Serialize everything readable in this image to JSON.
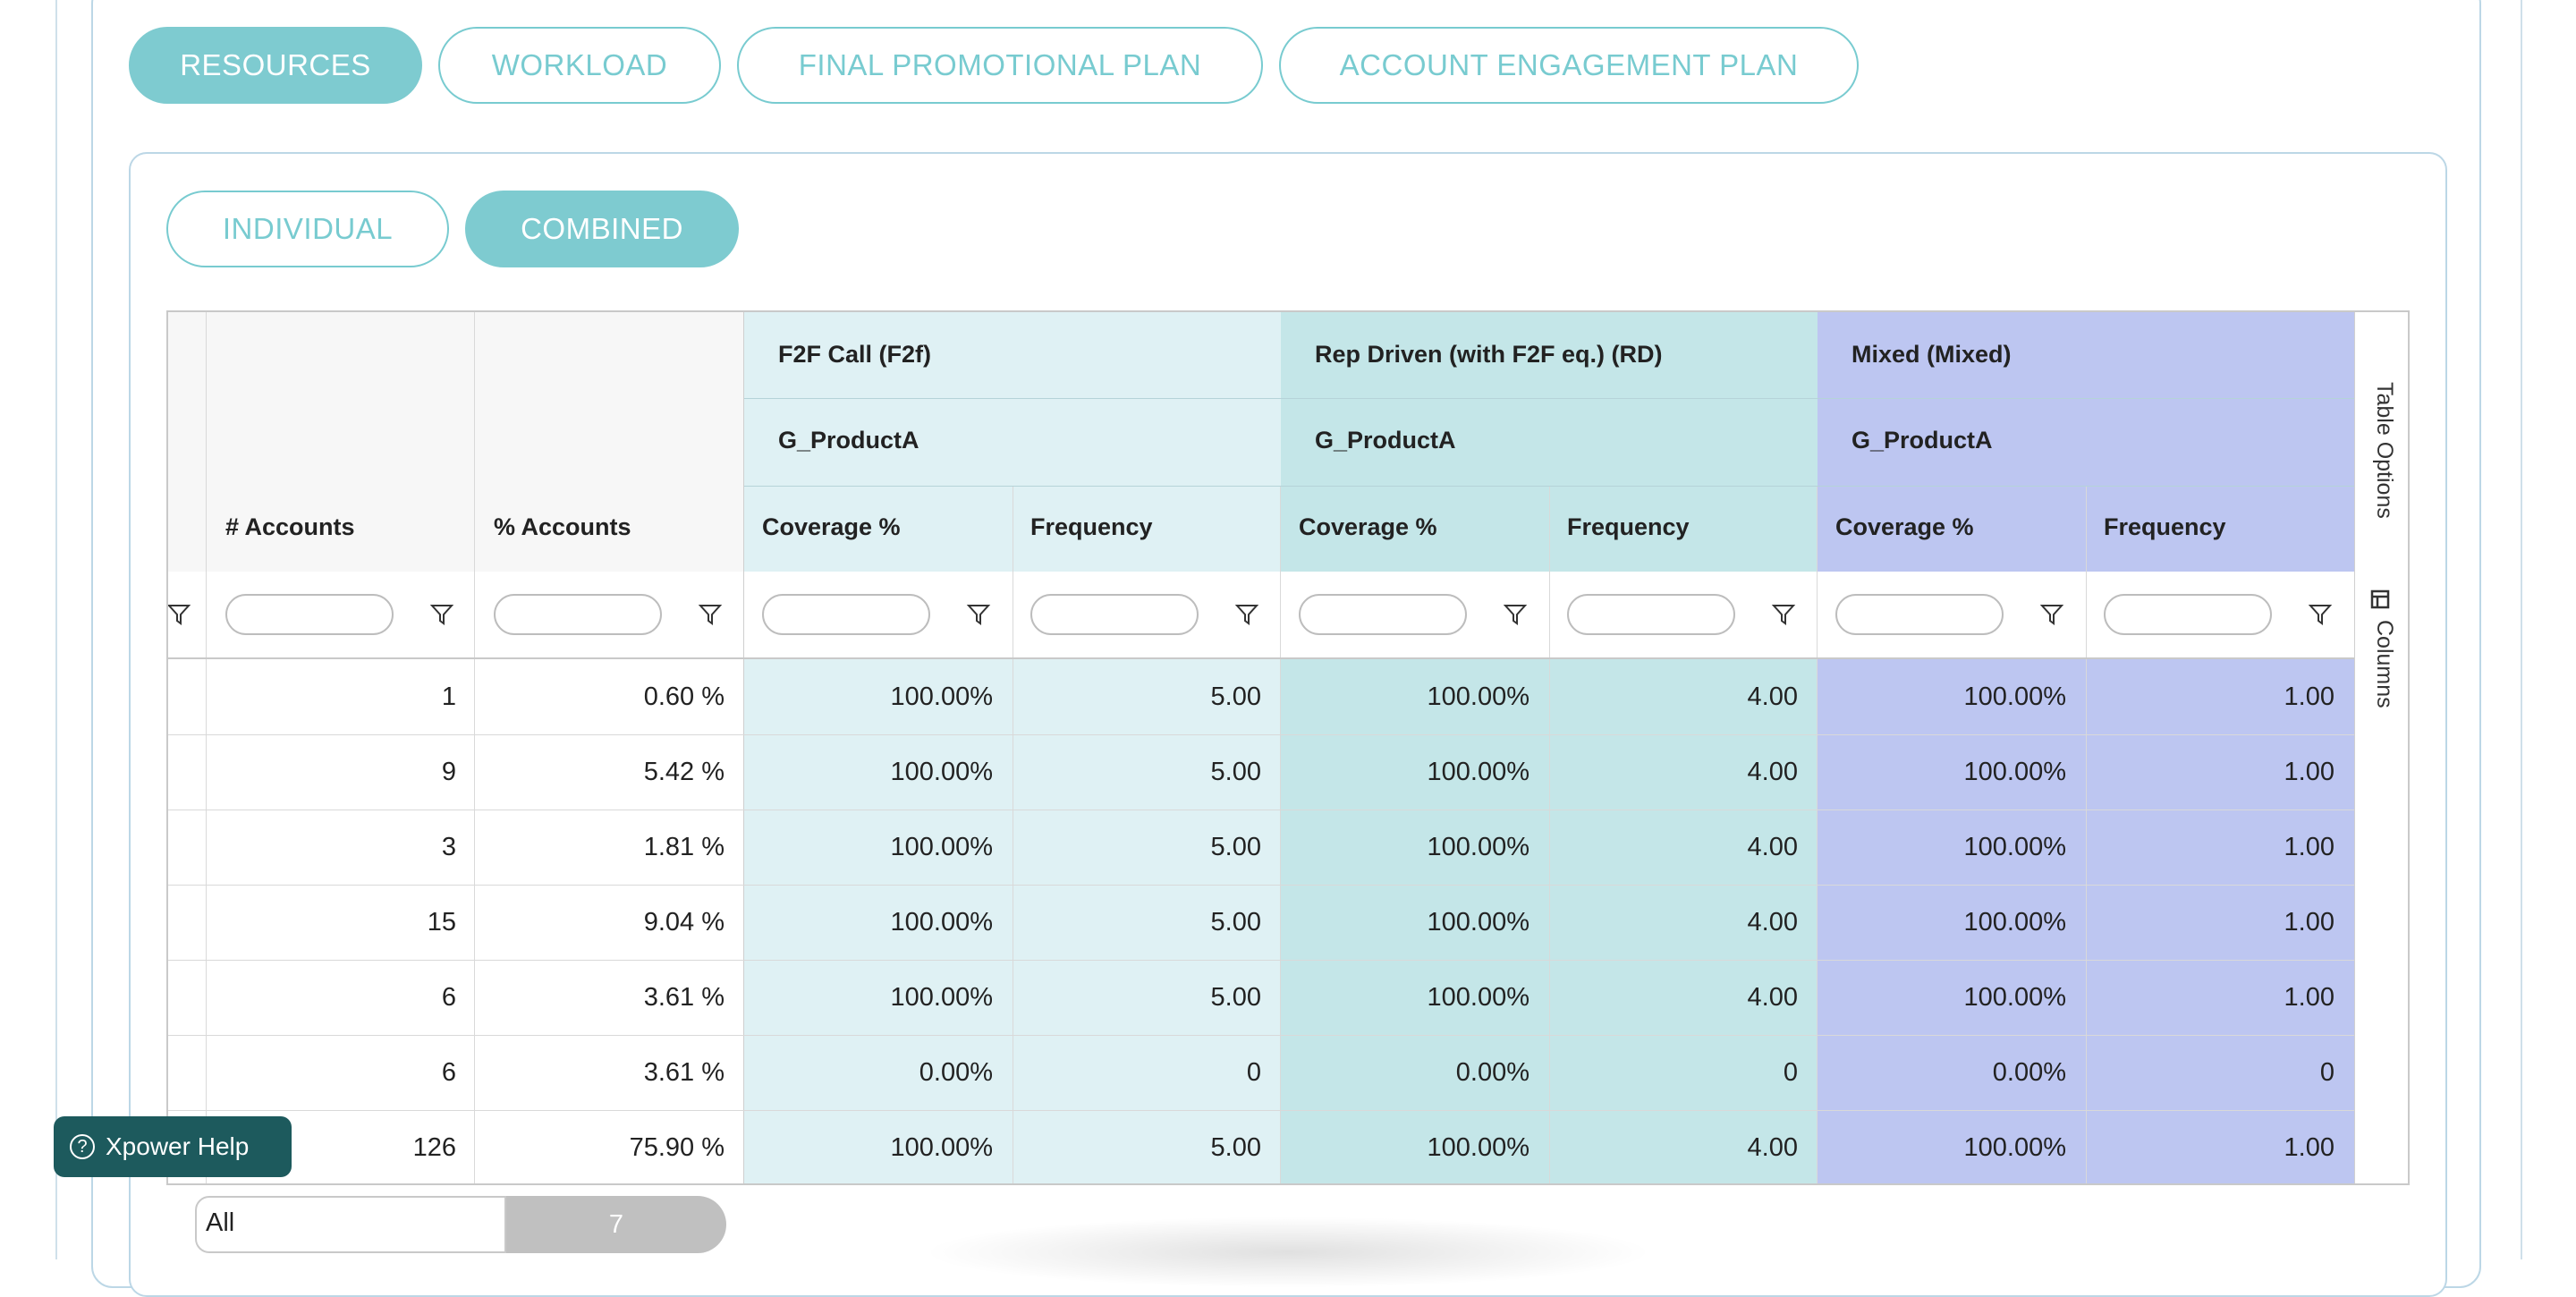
{
  "top_tabs": [
    {
      "label": "RESOURCES",
      "active": true
    },
    {
      "label": "WORKLOAD",
      "active": false
    },
    {
      "label": "FINAL PROMOTIONAL PLAN",
      "active": false
    },
    {
      "label": "ACCOUNT ENGAGEMENT PLAN",
      "active": false
    }
  ],
  "view_toggle": [
    {
      "label": "INDIVIDUAL",
      "active": false
    },
    {
      "label": "COMBINED",
      "active": true
    }
  ],
  "grid": {
    "group_headers": [
      {
        "label": "F2F Call (F2f)",
        "product": "G_ProductA",
        "color": "#dff1f4"
      },
      {
        "label": "Rep Driven (with F2F eq.) (RD)",
        "product": "G_ProductA",
        "color": "#c4e6e8"
      },
      {
        "label": "Mixed (Mixed)",
        "product": "G_ProductA",
        "color": "#bdc6f1"
      }
    ],
    "columns": [
      "# Accounts",
      "% Accounts",
      "Coverage %",
      "Frequency",
      "Coverage %",
      "Frequency",
      "Coverage %",
      "Frequency"
    ],
    "rows": [
      [
        "1",
        "0.60 %",
        "100.00%",
        "5.00",
        "100.00%",
        "4.00",
        "100.00%",
        "1.00"
      ],
      [
        "9",
        "5.42 %",
        "100.00%",
        "5.00",
        "100.00%",
        "4.00",
        "100.00%",
        "1.00"
      ],
      [
        "3",
        "1.81 %",
        "100.00%",
        "5.00",
        "100.00%",
        "4.00",
        "100.00%",
        "1.00"
      ],
      [
        "15",
        "9.04 %",
        "100.00%",
        "5.00",
        "100.00%",
        "4.00",
        "100.00%",
        "1.00"
      ],
      [
        "6",
        "3.61 %",
        "100.00%",
        "5.00",
        "100.00%",
        "4.00",
        "100.00%",
        "1.00"
      ],
      [
        "6",
        "3.61 %",
        "0.00%",
        "0",
        "0.00%",
        "0",
        "0.00%",
        "0"
      ],
      [
        "126",
        "75.90 %",
        "100.00%",
        "5.00",
        "100.00%",
        "4.00",
        "100.00%",
        "1.00"
      ]
    ],
    "side_panel": {
      "table_options": "Table Options",
      "columns": "Columns"
    }
  },
  "pager": {
    "scope": "All",
    "count": "7"
  },
  "help_button": {
    "label": "Xpower Help"
  }
}
